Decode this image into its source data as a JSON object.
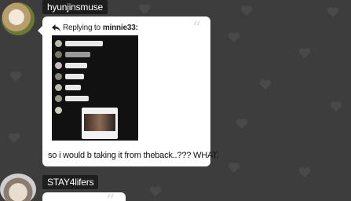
{
  "messages": [
    {
      "username": "hyunjinsmuse",
      "reply_prefix": "Replying to",
      "reply_to": "minnie33:",
      "text": "so i would b taking it from theback..??? WHAT."
    },
    {
      "username": "STAY4lifers"
    }
  ],
  "icons": {
    "quote": "quote-icon",
    "reply": "reply-arrow-icon",
    "background": "heart-pattern"
  },
  "colors": {
    "background": "#3d3d3d",
    "bubble": "#ffffff",
    "name_tag": "#1e1e1e"
  }
}
